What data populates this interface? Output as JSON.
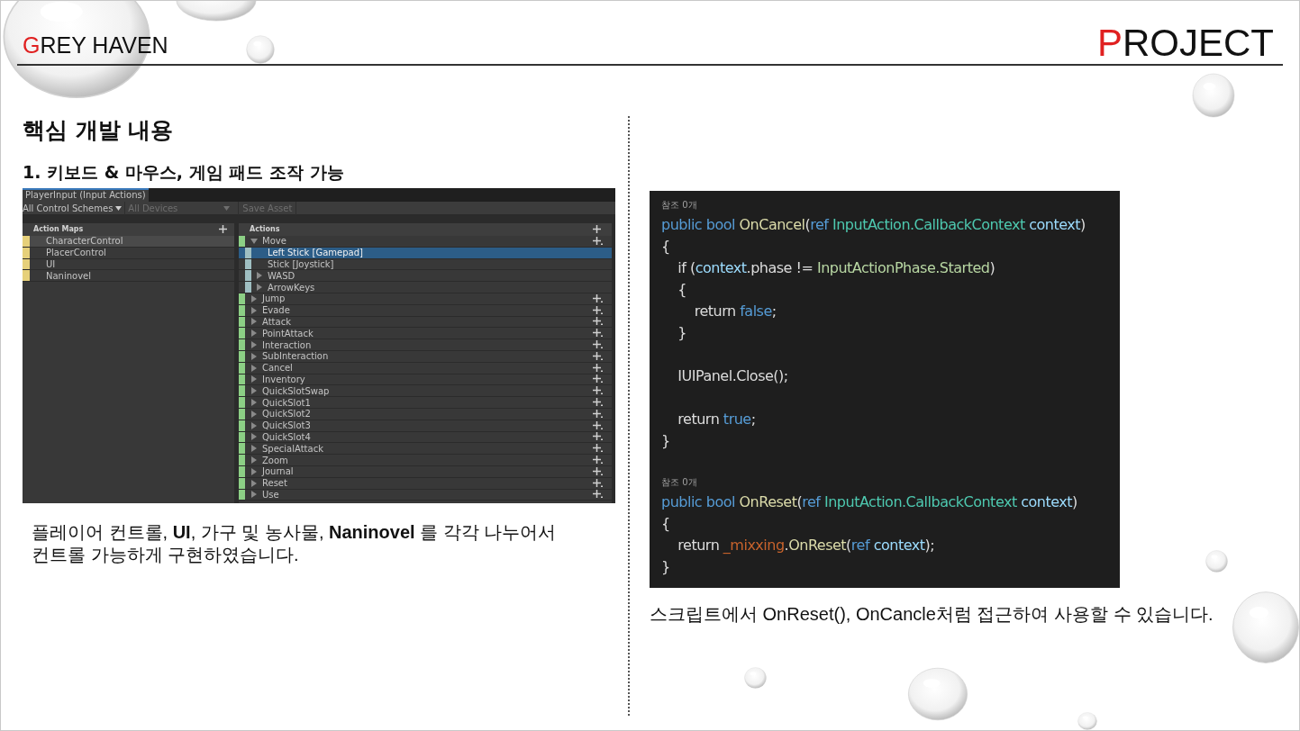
{
  "header": {
    "brand": {
      "initial": "G",
      "rest": "REY HAVEN"
    },
    "title": {
      "initial": "P",
      "rest": "ROJECT"
    }
  },
  "left": {
    "heading": "핵심 개발 내용",
    "subheading": "1. 키보드 & 마우스, 게임 패드 조작 가능",
    "editor": {
      "tab": "PlayerInput (Input Actions)",
      "schemes": "All Control Schemes",
      "devices": "All Devices",
      "save": "Save Asset",
      "maps_header": "Action Maps",
      "actions_header": "Actions",
      "maps": [
        {
          "label": "CharacterControl",
          "selected": true
        },
        {
          "label": "PlacerControl",
          "selected": false
        },
        {
          "label": "UI",
          "selected": false
        },
        {
          "label": "Naninovel",
          "selected": false
        }
      ],
      "actions": [
        {
          "label": "Move",
          "expanded": true,
          "selected": false,
          "children": [
            {
              "label": "Left Stick [Gamepad]",
              "kind": "binding",
              "selected": true
            },
            {
              "label": "Stick [Joystick]",
              "kind": "binding",
              "selected": false
            },
            {
              "label": "WASD",
              "kind": "composite",
              "selected": false
            },
            {
              "label": "ArrowKeys",
              "kind": "composite",
              "selected": false
            }
          ]
        },
        {
          "label": "Jump",
          "expanded": false,
          "selected": false
        },
        {
          "label": "Evade",
          "expanded": false,
          "selected": false
        },
        {
          "label": "Attack",
          "expanded": false,
          "selected": false
        },
        {
          "label": "PointAttack",
          "expanded": false,
          "selected": false
        },
        {
          "label": "Interaction",
          "expanded": false,
          "selected": false
        },
        {
          "label": "SubInteraction",
          "expanded": false,
          "selected": false
        },
        {
          "label": "Cancel",
          "expanded": false,
          "selected": false
        },
        {
          "label": "Inventory",
          "expanded": false,
          "selected": false
        },
        {
          "label": "QuickSlotSwap",
          "expanded": false,
          "selected": false
        },
        {
          "label": "QuickSlot1",
          "expanded": false,
          "selected": false
        },
        {
          "label": "QuickSlot2",
          "expanded": false,
          "selected": false
        },
        {
          "label": "QuickSlot3",
          "expanded": false,
          "selected": false
        },
        {
          "label": "QuickSlot4",
          "expanded": false,
          "selected": false
        },
        {
          "label": "SpecialAttack",
          "expanded": false,
          "selected": false
        },
        {
          "label": "Zoom",
          "expanded": false,
          "selected": false
        },
        {
          "label": "Journal",
          "expanded": false,
          "selected": false
        },
        {
          "label": "Reset",
          "expanded": false,
          "selected": false
        },
        {
          "label": "Use",
          "expanded": false,
          "selected": false
        }
      ]
    },
    "caption": "플레이어 컨트롤, **UI**, 가구 및 농사물, **Naninovel** 를 각각 나누어서 컨트롤 가능하게 구현하였습니다."
  },
  "right": {
    "code": [
      {
        "kind": "hint",
        "text": "참조 0개"
      },
      {
        "kind": "code",
        "tokens": [
          {
            "text": "public bool ",
            "kind": "keyword"
          },
          {
            "text": "OnCancel",
            "kind": "method"
          },
          {
            "text": "(",
            "kind": "plain"
          },
          {
            "text": "ref ",
            "kind": "keyword"
          },
          {
            "text": "InputAction.CallbackContext ",
            "kind": "type"
          },
          {
            "text": "context",
            "kind": "param"
          },
          {
            "text": ")",
            "kind": "plain"
          }
        ]
      },
      {
        "kind": "code",
        "tokens": [
          {
            "text": "{",
            "kind": "plain"
          }
        ]
      },
      {
        "kind": "code",
        "tokens": [
          {
            "text": "    if (",
            "kind": "plain"
          },
          {
            "text": "context",
            "kind": "param"
          },
          {
            "text": ".phase != ",
            "kind": "plain"
          },
          {
            "text": "InputActionPhase.Started",
            "kind": "enum"
          },
          {
            "text": ")",
            "kind": "plain"
          }
        ]
      },
      {
        "kind": "code",
        "tokens": [
          {
            "text": "    {",
            "kind": "plain"
          }
        ]
      },
      {
        "kind": "code",
        "tokens": [
          {
            "text": "        return ",
            "kind": "plain"
          },
          {
            "text": "false",
            "kind": "keyword"
          },
          {
            "text": ";",
            "kind": "plain"
          }
        ]
      },
      {
        "kind": "code",
        "tokens": [
          {
            "text": "    }",
            "kind": "plain"
          }
        ]
      },
      {
        "kind": "blank"
      },
      {
        "kind": "code",
        "tokens": [
          {
            "text": "    IUIPanel.Close();",
            "kind": "plain"
          }
        ]
      },
      {
        "kind": "blank"
      },
      {
        "kind": "code",
        "tokens": [
          {
            "text": "    return ",
            "kind": "plain"
          },
          {
            "text": "true",
            "kind": "keyword"
          },
          {
            "text": ";",
            "kind": "plain"
          }
        ]
      },
      {
        "kind": "code",
        "tokens": [
          {
            "text": "}",
            "kind": "plain"
          }
        ]
      },
      {
        "kind": "blank"
      },
      {
        "kind": "hint",
        "text": "참조 0개"
      },
      {
        "kind": "code",
        "tokens": [
          {
            "text": "public bool ",
            "kind": "keyword"
          },
          {
            "text": "OnReset",
            "kind": "method"
          },
          {
            "text": "(",
            "kind": "plain"
          },
          {
            "text": "ref ",
            "kind": "keyword"
          },
          {
            "text": "InputAction.CallbackContext ",
            "kind": "type"
          },
          {
            "text": "context",
            "kind": "param"
          },
          {
            "text": ")",
            "kind": "plain"
          }
        ]
      },
      {
        "kind": "code",
        "tokens": [
          {
            "text": "{",
            "kind": "plain"
          }
        ]
      },
      {
        "kind": "code",
        "tokens": [
          {
            "text": "    return ",
            "kind": "plain"
          },
          {
            "text": "_mixxing",
            "kind": "field"
          },
          {
            "text": ".",
            "kind": "plain"
          },
          {
            "text": "OnReset",
            "kind": "method"
          },
          {
            "text": "(",
            "kind": "plain"
          },
          {
            "text": "ref ",
            "kind": "keyword"
          },
          {
            "text": "context",
            "kind": "param"
          },
          {
            "text": ");",
            "kind": "plain"
          }
        ]
      },
      {
        "kind": "code",
        "tokens": [
          {
            "text": "}",
            "kind": "plain"
          }
        ]
      }
    ],
    "caption": "스크립트에서 OnReset(), OnCancle처럼 접근하여 사용할 수 있습니다."
  }
}
